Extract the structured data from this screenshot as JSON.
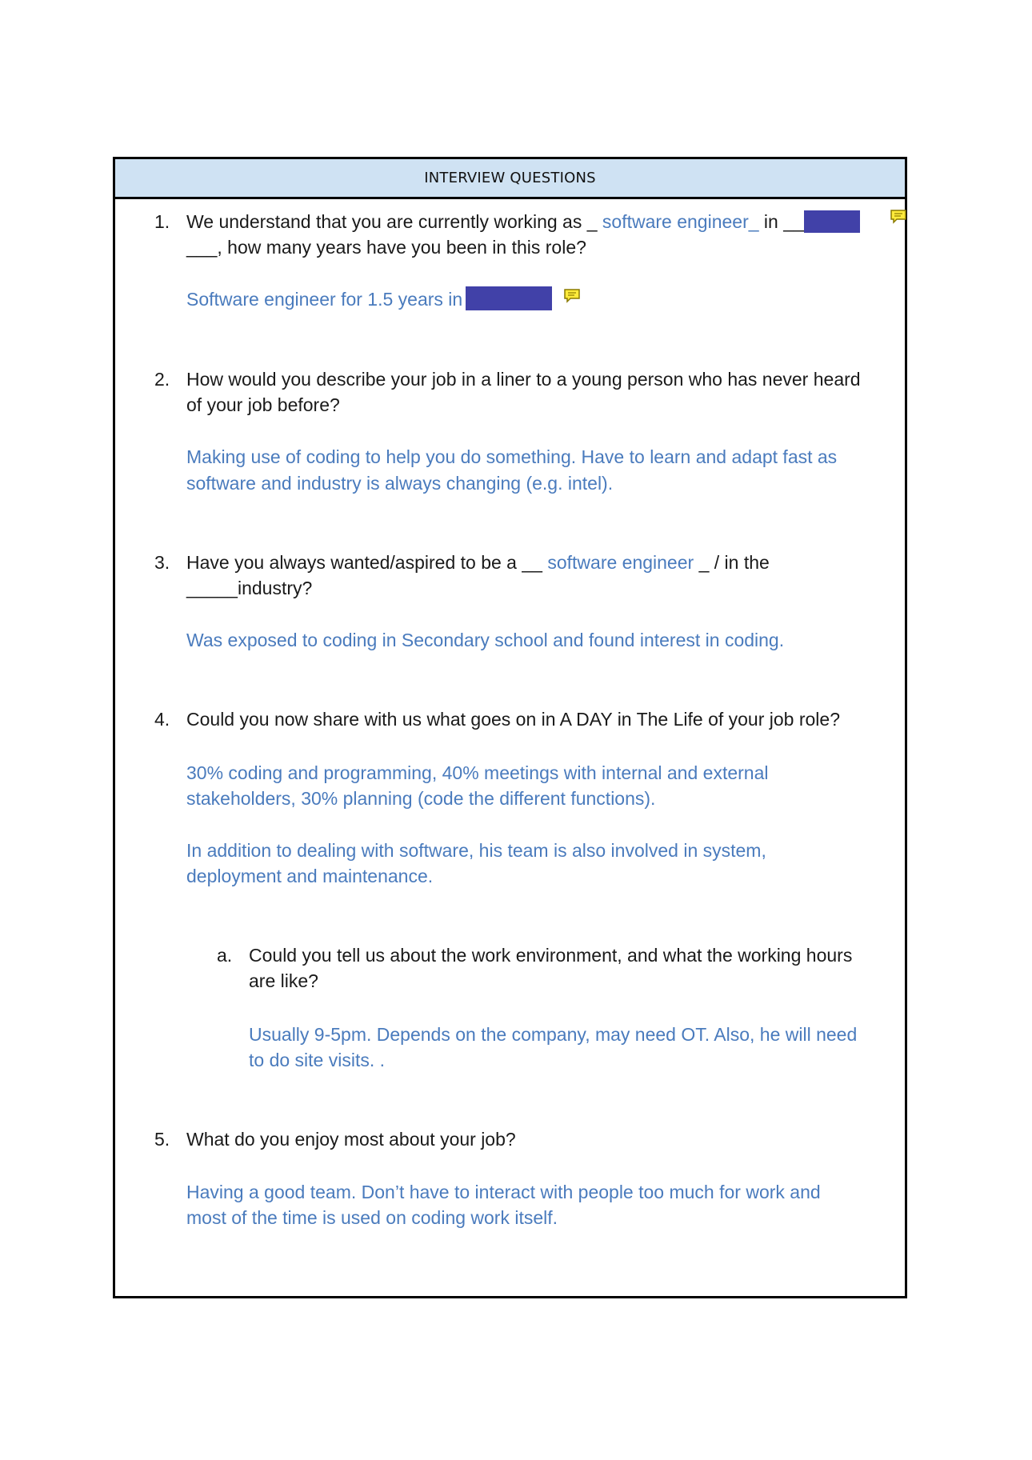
{
  "header": {
    "title": "INTERVIEW QUESTIONS"
  },
  "colors": {
    "answer": "#4a7bbd",
    "header_bg": "#cfe2f3",
    "redaction": "#4141a8",
    "comment_icon": "#ffeb3b"
  },
  "q1": {
    "number": "1.",
    "line1_prefix": "We understand that you are currently working as _",
    "line1_role": "software engineer_",
    "line1_suffix": "in __",
    "line2": "___, how many years have you been in this role?",
    "answer": "Software engineer for 1.5 years in"
  },
  "q2": {
    "number": "2.",
    "line1": "How would you describe your job in a liner to a young person who has never heard",
    "line2": "of your job before?",
    "answer_line1": "Making use of coding to help you do something. Have to learn and adapt fast as",
    "answer_line2": "software and industry is always changing (e.g. intel)."
  },
  "q3": {
    "number": "3.",
    "line1_prefix": "Have you always wanted/aspired to be a __",
    "line1_role": "software engineer",
    "line1_suffix": "_ / in the",
    "line2": "_____industry?",
    "answer": "Was exposed to coding in Secondary school and found interest in coding."
  },
  "q4": {
    "number": "4.",
    "line1": "Could you now share with us what goes on in A DAY  in The Life of your job role?",
    "answer1_line1": "30% coding and programming, 40% meetings with internal and external",
    "answer1_line2": "stakeholders, 30% planning (code the different functions).",
    "answer2_line1": "In addition to dealing with software, his team is also involved in system,",
    "answer2_line2": "deployment and maintenance."
  },
  "q4a": {
    "letter": "a.",
    "line1": "Could you tell us about the work environment, and what the working hours",
    "line2": "are like?",
    "answer_line1": "Usually 9-5pm. Depends on the company, may need OT. Also, he will need",
    "answer_line2": "to do site visits. ."
  },
  "q5": {
    "number": "5.",
    "line1": "What do you enjoy most about your job?",
    "answer_line1": "Having a good team. Don’t have to interact with people too much for work and",
    "answer_line2": "most of the time is used on coding work itself."
  }
}
